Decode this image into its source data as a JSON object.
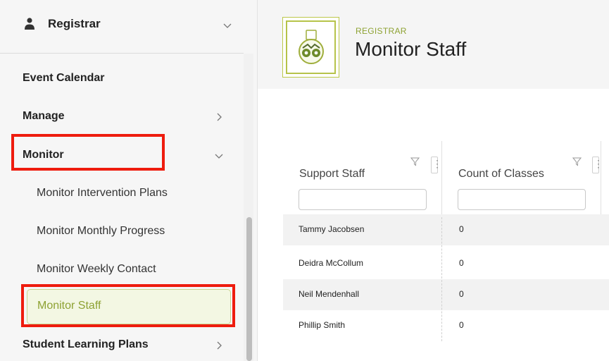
{
  "sidebar": {
    "role": {
      "label": "Registrar",
      "icon": "person-icon"
    },
    "items": [
      {
        "label": "Event Calendar"
      },
      {
        "label": "Manage"
      },
      {
        "label": "Monitor"
      },
      {
        "label": "Student Learning Plans"
      }
    ],
    "monitor_subitems": [
      {
        "label": "Monitor Intervention Plans"
      },
      {
        "label": "Monitor Monthly Progress"
      },
      {
        "label": "Monitor Weekly Contact"
      },
      {
        "label": "Monitor Staff"
      }
    ]
  },
  "header": {
    "breadcrumb": "REGISTRAR",
    "title": "Monitor Staff",
    "logo_icon": "binoculars-icon"
  },
  "table": {
    "columns": [
      {
        "label": "Support Staff"
      },
      {
        "label": "Count of Classes"
      }
    ],
    "rows": [
      {
        "staff": "Tammy Jacobsen",
        "count": "0"
      },
      {
        "staff": "Deidra McCollum",
        "count": "0"
      },
      {
        "staff": "Neil Mendenhall",
        "count": "0"
      },
      {
        "staff": "Phillip Smith",
        "count": "0"
      }
    ]
  },
  "colors": {
    "accent": "#8ea233",
    "highlight": "#ee1c0e"
  }
}
